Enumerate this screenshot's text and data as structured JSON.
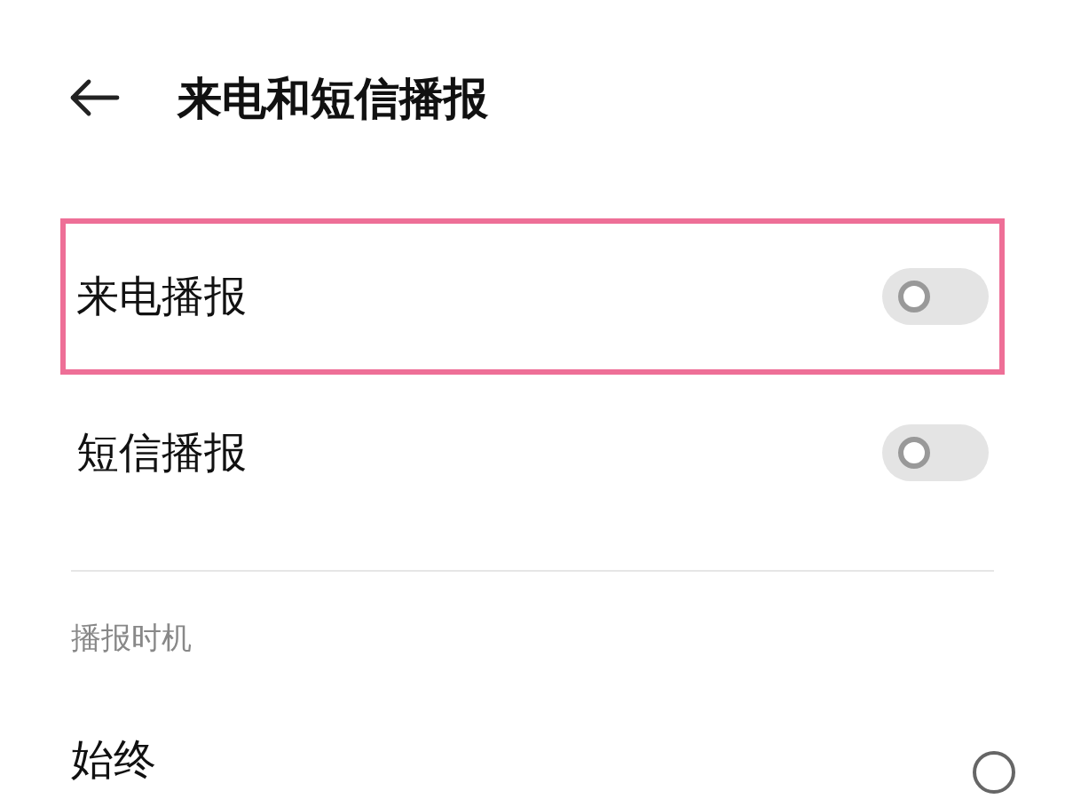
{
  "header": {
    "title": "来电和短信播报"
  },
  "toggles": [
    {
      "label": "来电播报",
      "on": false,
      "highlighted": true
    },
    {
      "label": "短信播报",
      "on": false,
      "highlighted": false
    }
  ],
  "section": {
    "title": "播报时机"
  },
  "options": [
    {
      "label": "始终",
      "selected": false
    }
  ]
}
